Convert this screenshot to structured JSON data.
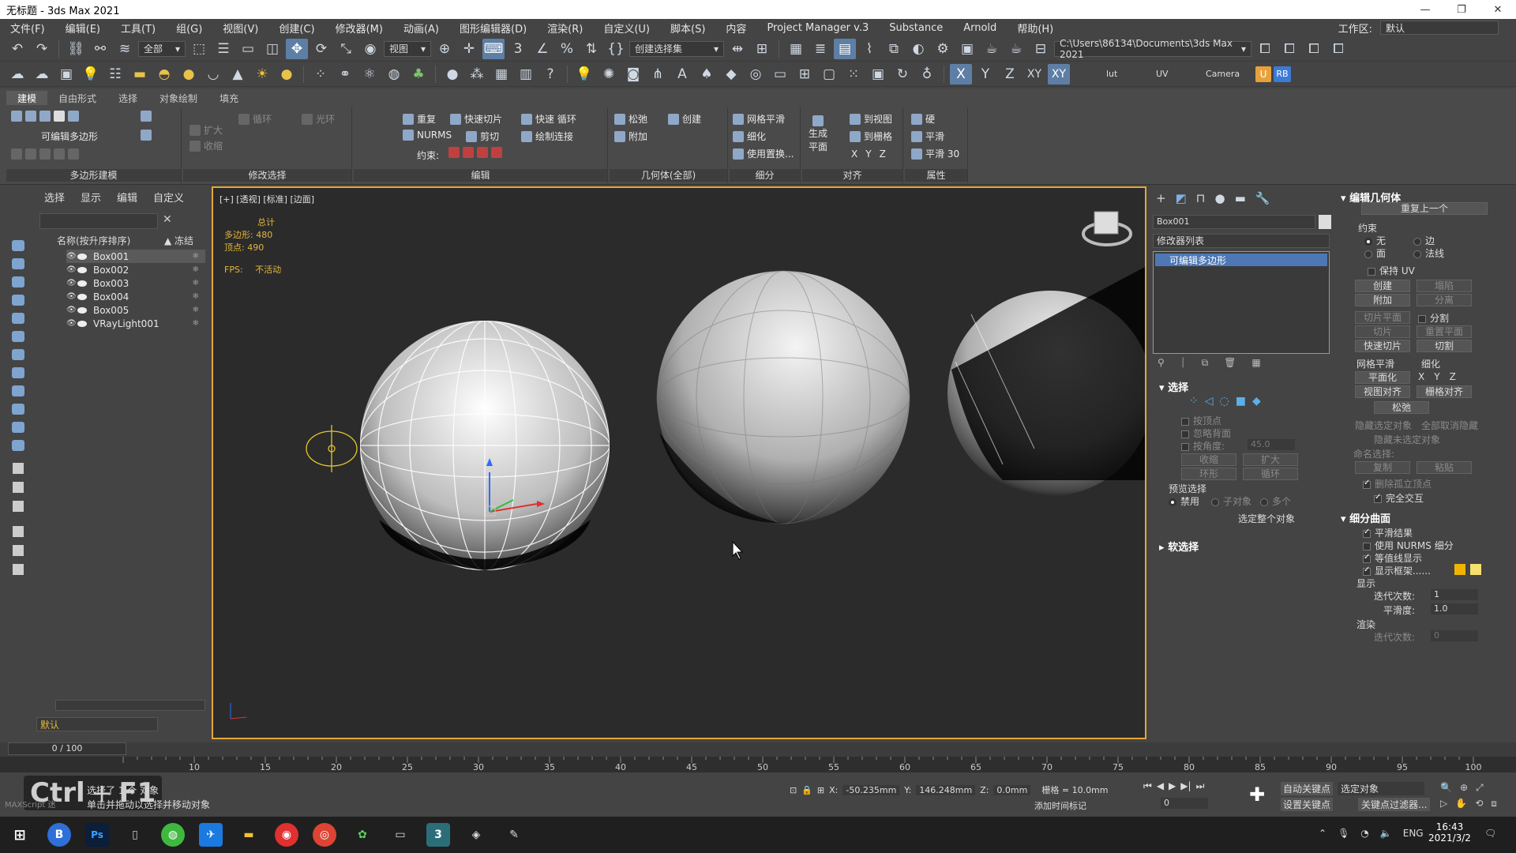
{
  "app": {
    "title": "无标题 - 3ds Max 2021",
    "win_min": "—",
    "win_max": "❐",
    "win_close": "✕"
  },
  "menu": {
    "items": [
      "文件(F)",
      "编辑(E)",
      "工具(T)",
      "组(G)",
      "视图(V)",
      "创建(C)",
      "修改器(M)",
      "动画(A)",
      "图形编辑器(D)",
      "渲染(R)",
      "自定义(U)",
      "脚本(S)",
      "内容",
      "Project Manager v.3",
      "Substance",
      "Arnold",
      "帮助(H)"
    ],
    "workspace_label": "工作区:",
    "workspace_value": "默认"
  },
  "toolbar1": {
    "filter_dropdown": "全部",
    "view_dropdown": "视图",
    "selection_set": "创建选择集",
    "path": "C:\\Users\\86134\\Documents\\3ds Max 2021"
  },
  "toolbar2": {
    "axis_x": "X",
    "axis_y": "Y",
    "axis_z": "Z",
    "axis_xy": "XY",
    "axis_xy2": "XY",
    "lut": "lut",
    "uv": "UV",
    "camera": "Camera",
    "badge_u": "U",
    "badge_rb": "RB"
  },
  "ribbon": {
    "tabs": [
      "建模",
      "自由形式",
      "选择",
      "对象绘制",
      "填充"
    ],
    "group_poly": {
      "label": "多边形建模",
      "editable_poly": "可编辑多边形"
    },
    "group_modsel": {
      "label": "修改选择",
      "loop": "循环",
      "ring": "光环",
      "grow": "扩大",
      "shrink": "收缩"
    },
    "group_edit": {
      "label": "编辑",
      "repeat": "重复",
      "quickslice": "快速切片",
      "quickloop": "快速 循环",
      "nurms": "NURMS",
      "cut": "剪切",
      "drawconnect": "绘制连接",
      "constraint": "约束:"
    },
    "group_geom": {
      "label": "几何体(全部)",
      "relax": "松弛",
      "create": "创建",
      "attach": "附加"
    },
    "group_sub": {
      "label": "细分",
      "meshsmooth": "网格平滑",
      "tessellate": "细化",
      "usedisp": "使用置换..."
    },
    "group_align": {
      "label": "对齐",
      "genplane": "生成",
      "genplane2": "平面",
      "toview": "到视图",
      "togrid": "到栅格",
      "x": "X",
      "y": "Y",
      "z": "Z"
    },
    "group_props": {
      "label": "属性",
      "hard": "硬",
      "smooth": "平滑",
      "smooth30": "平滑 30"
    }
  },
  "scene": {
    "tabs": [
      "选择",
      "显示",
      "编辑",
      "自定义"
    ],
    "header_name": "名称(按升序排序)",
    "header_freeze": "▲ 冻结",
    "rows": [
      "Box001",
      "Box002",
      "Box003",
      "Box004",
      "Box005",
      "VRayLight001"
    ],
    "layer": "默认"
  },
  "viewport": {
    "label": "[+] [透视] [标准] [边面]",
    "stats_total": "总计",
    "stats_poly_label": "多边形:",
    "stats_poly": "480",
    "stats_vert_label": "顶点:",
    "stats_vert": "490",
    "fps_label": "FPS:",
    "fps_value": "不活动"
  },
  "cmd": {
    "object_name": "Box001",
    "modifier_list": "修改器列表",
    "stack_item": "可编辑多边形",
    "selection_title": "选择",
    "by_vertex": "按顶点",
    "ignore_back": "忽略背面",
    "by_angle": "按角度:",
    "angle_value": "45.0",
    "shrink": "收缩",
    "grow": "扩大",
    "ring": "环形",
    "loop": "循环",
    "preview_title": "预览选择",
    "preview_off": "禁用",
    "preview_sub": "子对象",
    "preview_multi": "多个",
    "select_whole": "选定整个对象",
    "soft_sel": "软选择"
  },
  "editgeo": {
    "title": "编辑几何体",
    "repeat_last": "重复上一个",
    "constraint": "约束",
    "c_none": "无",
    "c_edge": "边",
    "c_face": "面",
    "c_normal": "法线",
    "preserve_uv": "保持 UV",
    "create": "创建",
    "collapse": "塌陷",
    "attach": "附加",
    "detach": "分离",
    "slice_plane": "切片平面",
    "split": "分割",
    "slice": "切片",
    "reset_plane": "重置平面",
    "quickslice": "快速切片",
    "cut": "切割",
    "meshsmooth": "网格平滑",
    "tessellate": "细化",
    "planarize": "平面化",
    "px": "X",
    "py": "Y",
    "pz": "Z",
    "view_align": "视图对齐",
    "grid_align": "栅格对齐",
    "relax": "松弛",
    "hide_sel": "隐藏选定对象",
    "unhide_all": "全部取消隐藏",
    "hide_unsel": "隐藏未选定对象",
    "named_sel": "命名选择:",
    "copy": "复制",
    "paste": "粘贴",
    "delete_iso": "删除孤立顶点",
    "full_interact": "完全交互"
  },
  "subdiv": {
    "title": "细分曲面",
    "smooth_result": "平滑结果",
    "use_nurms": "使用 NURMS 细分",
    "isoline": "等值线显示",
    "show_cage": "显示框架......",
    "display": "显示",
    "iterations": "迭代次数:",
    "iter_value": "1",
    "smoothness": "平滑度:",
    "smooth_value": "1.0",
    "render": "渲染",
    "iter_render": "迭代次数:",
    "iter_render_value": "0"
  },
  "timeline": {
    "frame_counter": "0 / 100",
    "ticks": [
      "10",
      "15",
      "20",
      "25",
      "30",
      "35",
      "40",
      "45",
      "50",
      "55",
      "60",
      "65",
      "70",
      "75",
      "80",
      "85",
      "90",
      "95",
      "100"
    ]
  },
  "status": {
    "selected": "选择了 1 个 对象",
    "hint": "单击并拖动以选择并移动对象",
    "maxscript": "MAXScript 迷",
    "x_label": "X:",
    "x_value": "-50.235mm",
    "y_label": "Y:",
    "y_value": "146.248mm",
    "z_label": "Z:",
    "z_value": "0.0mm",
    "grid": "栅格 = 10.0mm",
    "add_time_tag": "添加时间标记",
    "autokey": "自动关键点",
    "setkey": "设置关键点",
    "sel_object": "选定对象",
    "key_filter": "关键点过滤器...",
    "frame_value": "0",
    "key_overlay_ctrl": "Ctrl",
    "key_overlay_plus": "+",
    "key_overlay_f1": "F1"
  },
  "taskbar": {
    "lang": "ENG",
    "time": "16:43",
    "date": "2021/3/2"
  },
  "colors": {
    "accent": "#5e7fa5",
    "viewport_border": "#e3a73a",
    "stats": "#e3b63c"
  }
}
